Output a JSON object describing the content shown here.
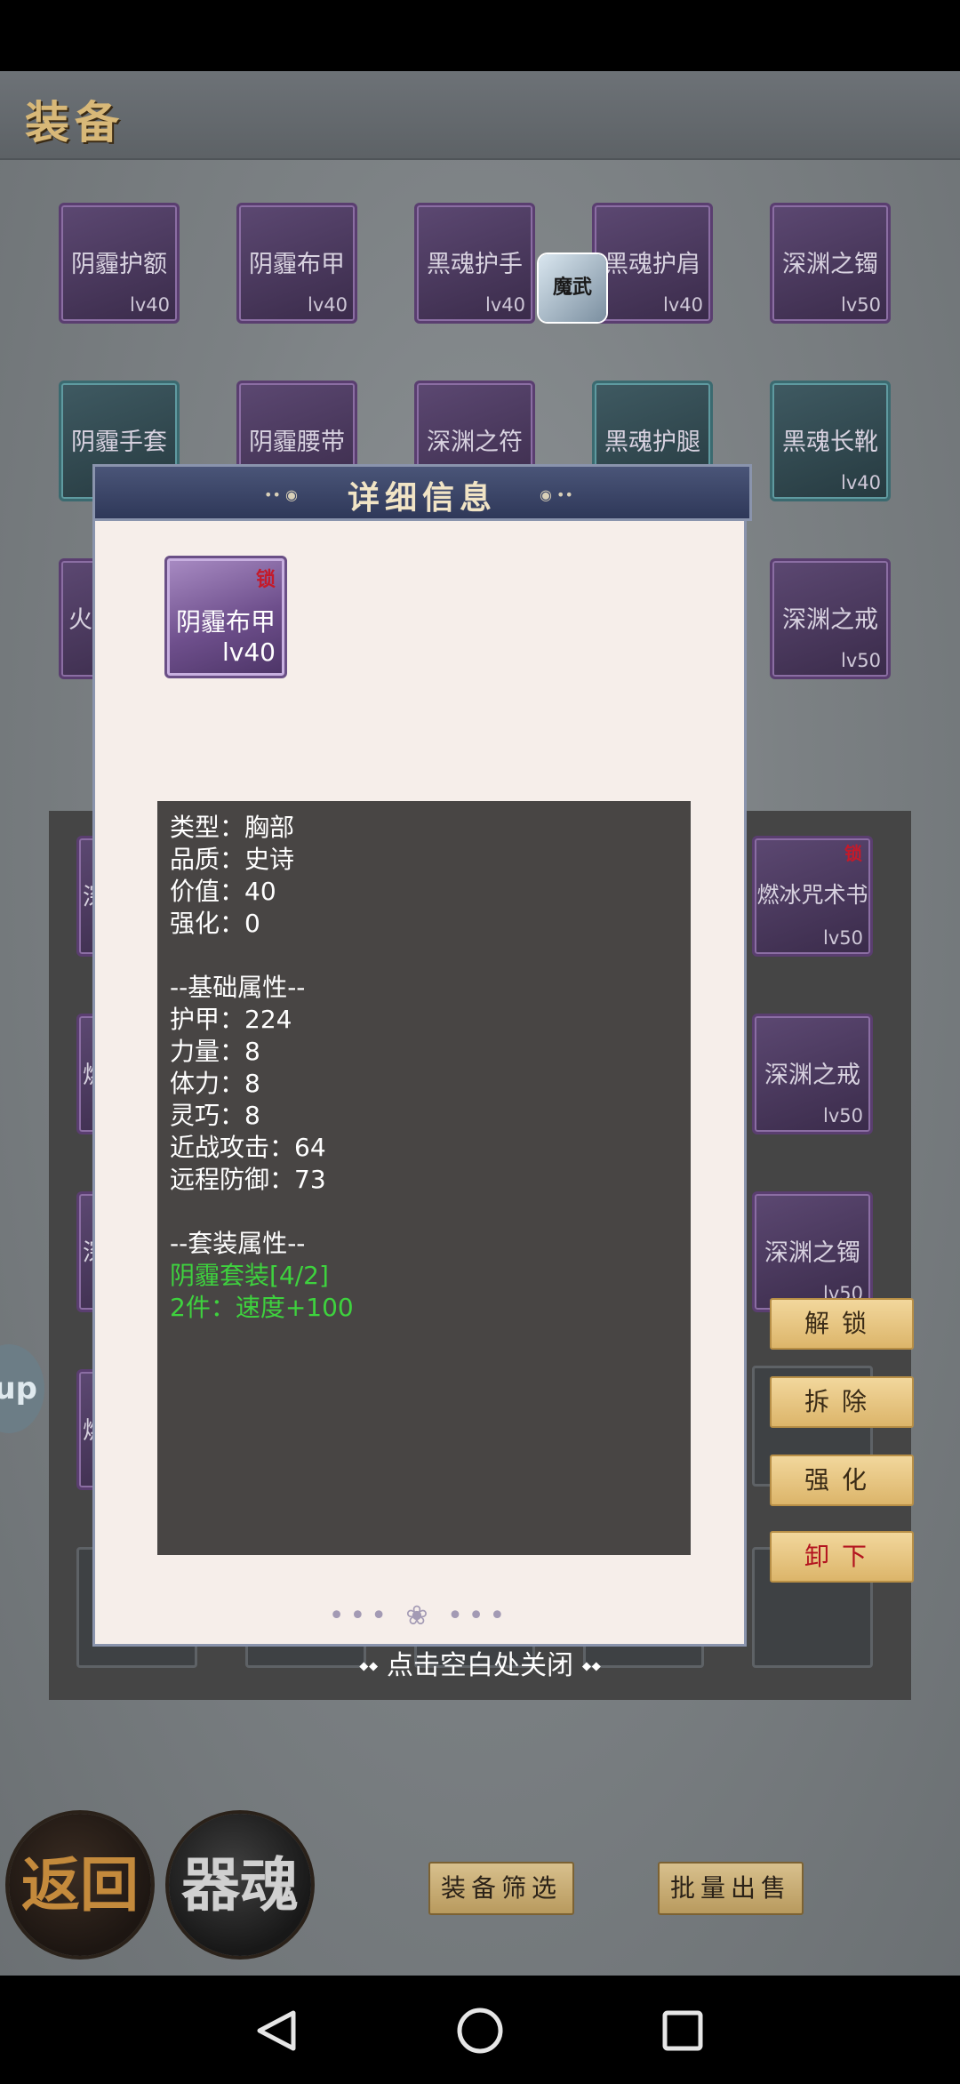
{
  "header": {
    "title": "装备"
  },
  "float_avatar": {
    "label": "魔武"
  },
  "equipment_rows": [
    [
      {
        "name": "阴霾护额",
        "level": "lv40",
        "variant": "purple"
      },
      {
        "name": "阴霾布甲",
        "level": "lv40",
        "variant": "purple"
      },
      {
        "name": "黑魂护手",
        "level": "lv40",
        "variant": "purple"
      },
      {
        "name": "黑魂护肩",
        "level": "lv40",
        "variant": "purple"
      },
      {
        "name": "深渊之镯",
        "level": "lv50",
        "variant": "purple"
      }
    ],
    [
      {
        "name": "阴霾手套",
        "level": "",
        "variant": "teal"
      },
      {
        "name": "阴霾腰带",
        "level": "",
        "variant": "purple"
      },
      {
        "name": "深渊之符",
        "level": "",
        "variant": "purple"
      },
      {
        "name": "黑魂护腿",
        "level": "",
        "variant": "teal"
      },
      {
        "name": "黑魂长靴",
        "level": "lv40",
        "variant": "teal"
      }
    ],
    [
      {
        "name": "火",
        "level": "",
        "variant": "purple"
      },
      {
        "name": "深渊之戒",
        "level": "lv50",
        "variant": "purple"
      }
    ]
  ],
  "bag_items": [
    {
      "name": "燃冰咒术书",
      "level": "lv50",
      "locked": true,
      "lock_text": "锁"
    },
    {
      "name": "深渊之戒",
      "level": "lv50"
    },
    {
      "name": "深渊之镯",
      "level": "lv50"
    }
  ],
  "bag_left_fragments": [
    "深",
    "燃",
    "深",
    "燃"
  ],
  "side_buttons": {
    "unlock": "解锁",
    "dismantle": "拆除",
    "enhance": "强化",
    "unequip": "卸下"
  },
  "bottom_buttons": {
    "filter": "装备筛选",
    "bulk_sell": "批量出售",
    "back": "返回",
    "soul": "器魂"
  },
  "up_bubble": "up",
  "dialog": {
    "title": "详细信息",
    "item": {
      "name": "阴霾布甲",
      "level": "lv40",
      "lock_text": "锁"
    },
    "info_lines": [
      {
        "text": "类型：胸部",
        "color": "#ffffff"
      },
      {
        "text": "品质：史诗",
        "color": "#ffffff"
      },
      {
        "text": "价值：40",
        "color": "#ffffff"
      },
      {
        "text": "强化：0",
        "color": "#ffffff"
      },
      {
        "text": "",
        "color": "#ffffff"
      },
      {
        "text": "--基础属性--",
        "color": "#ffffff"
      },
      {
        "text": "护甲：224",
        "color": "#ffffff"
      },
      {
        "text": "力量：8",
        "color": "#ffffff"
      },
      {
        "text": "体力：8",
        "color": "#ffffff"
      },
      {
        "text": "灵巧：8",
        "color": "#ffffff"
      },
      {
        "text": "近战攻击：64",
        "color": "#ffffff"
      },
      {
        "text": "远程防御：73",
        "color": "#ffffff"
      },
      {
        "text": "",
        "color": "#ffffff"
      },
      {
        "text": "--套装属性--",
        "color": "#ffffff"
      },
      {
        "text": "阴霾套装[4/2]",
        "color": "#3ed23e"
      },
      {
        "text": "2件：速度+100",
        "color": "#3ed23e"
      }
    ]
  },
  "close_hint": "点击空白处关闭"
}
